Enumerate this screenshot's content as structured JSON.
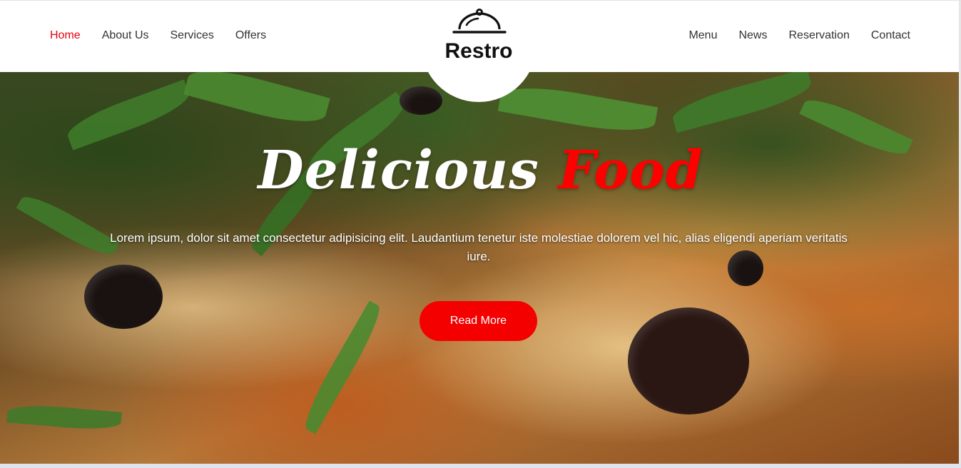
{
  "header": {
    "brand": "Restro",
    "nav_left": [
      {
        "label": "Home",
        "active": true
      },
      {
        "label": "About Us",
        "active": false
      },
      {
        "label": "Services",
        "active": false
      },
      {
        "label": "Offers",
        "active": false
      }
    ],
    "nav_right": [
      {
        "label": "Menu",
        "active": false
      },
      {
        "label": "News",
        "active": false
      },
      {
        "label": "Reservation",
        "active": false
      },
      {
        "label": "Contact",
        "active": false
      }
    ]
  },
  "hero": {
    "title_main": "Delicious ",
    "title_accent": "Food",
    "description": "Lorem ipsum, dolor sit amet consectetur adipisicing elit. Laudantium tenetur iste molestiae dolorem vel hic, alias eligendi aperiam veritatis iure.",
    "cta_label": "Read More",
    "background_image": "pizza-with-arugula-and-olives"
  },
  "colors": {
    "accent": "#e8000f",
    "button": "#f40000",
    "text_dark": "#333333",
    "brand_text": "#111111"
  }
}
